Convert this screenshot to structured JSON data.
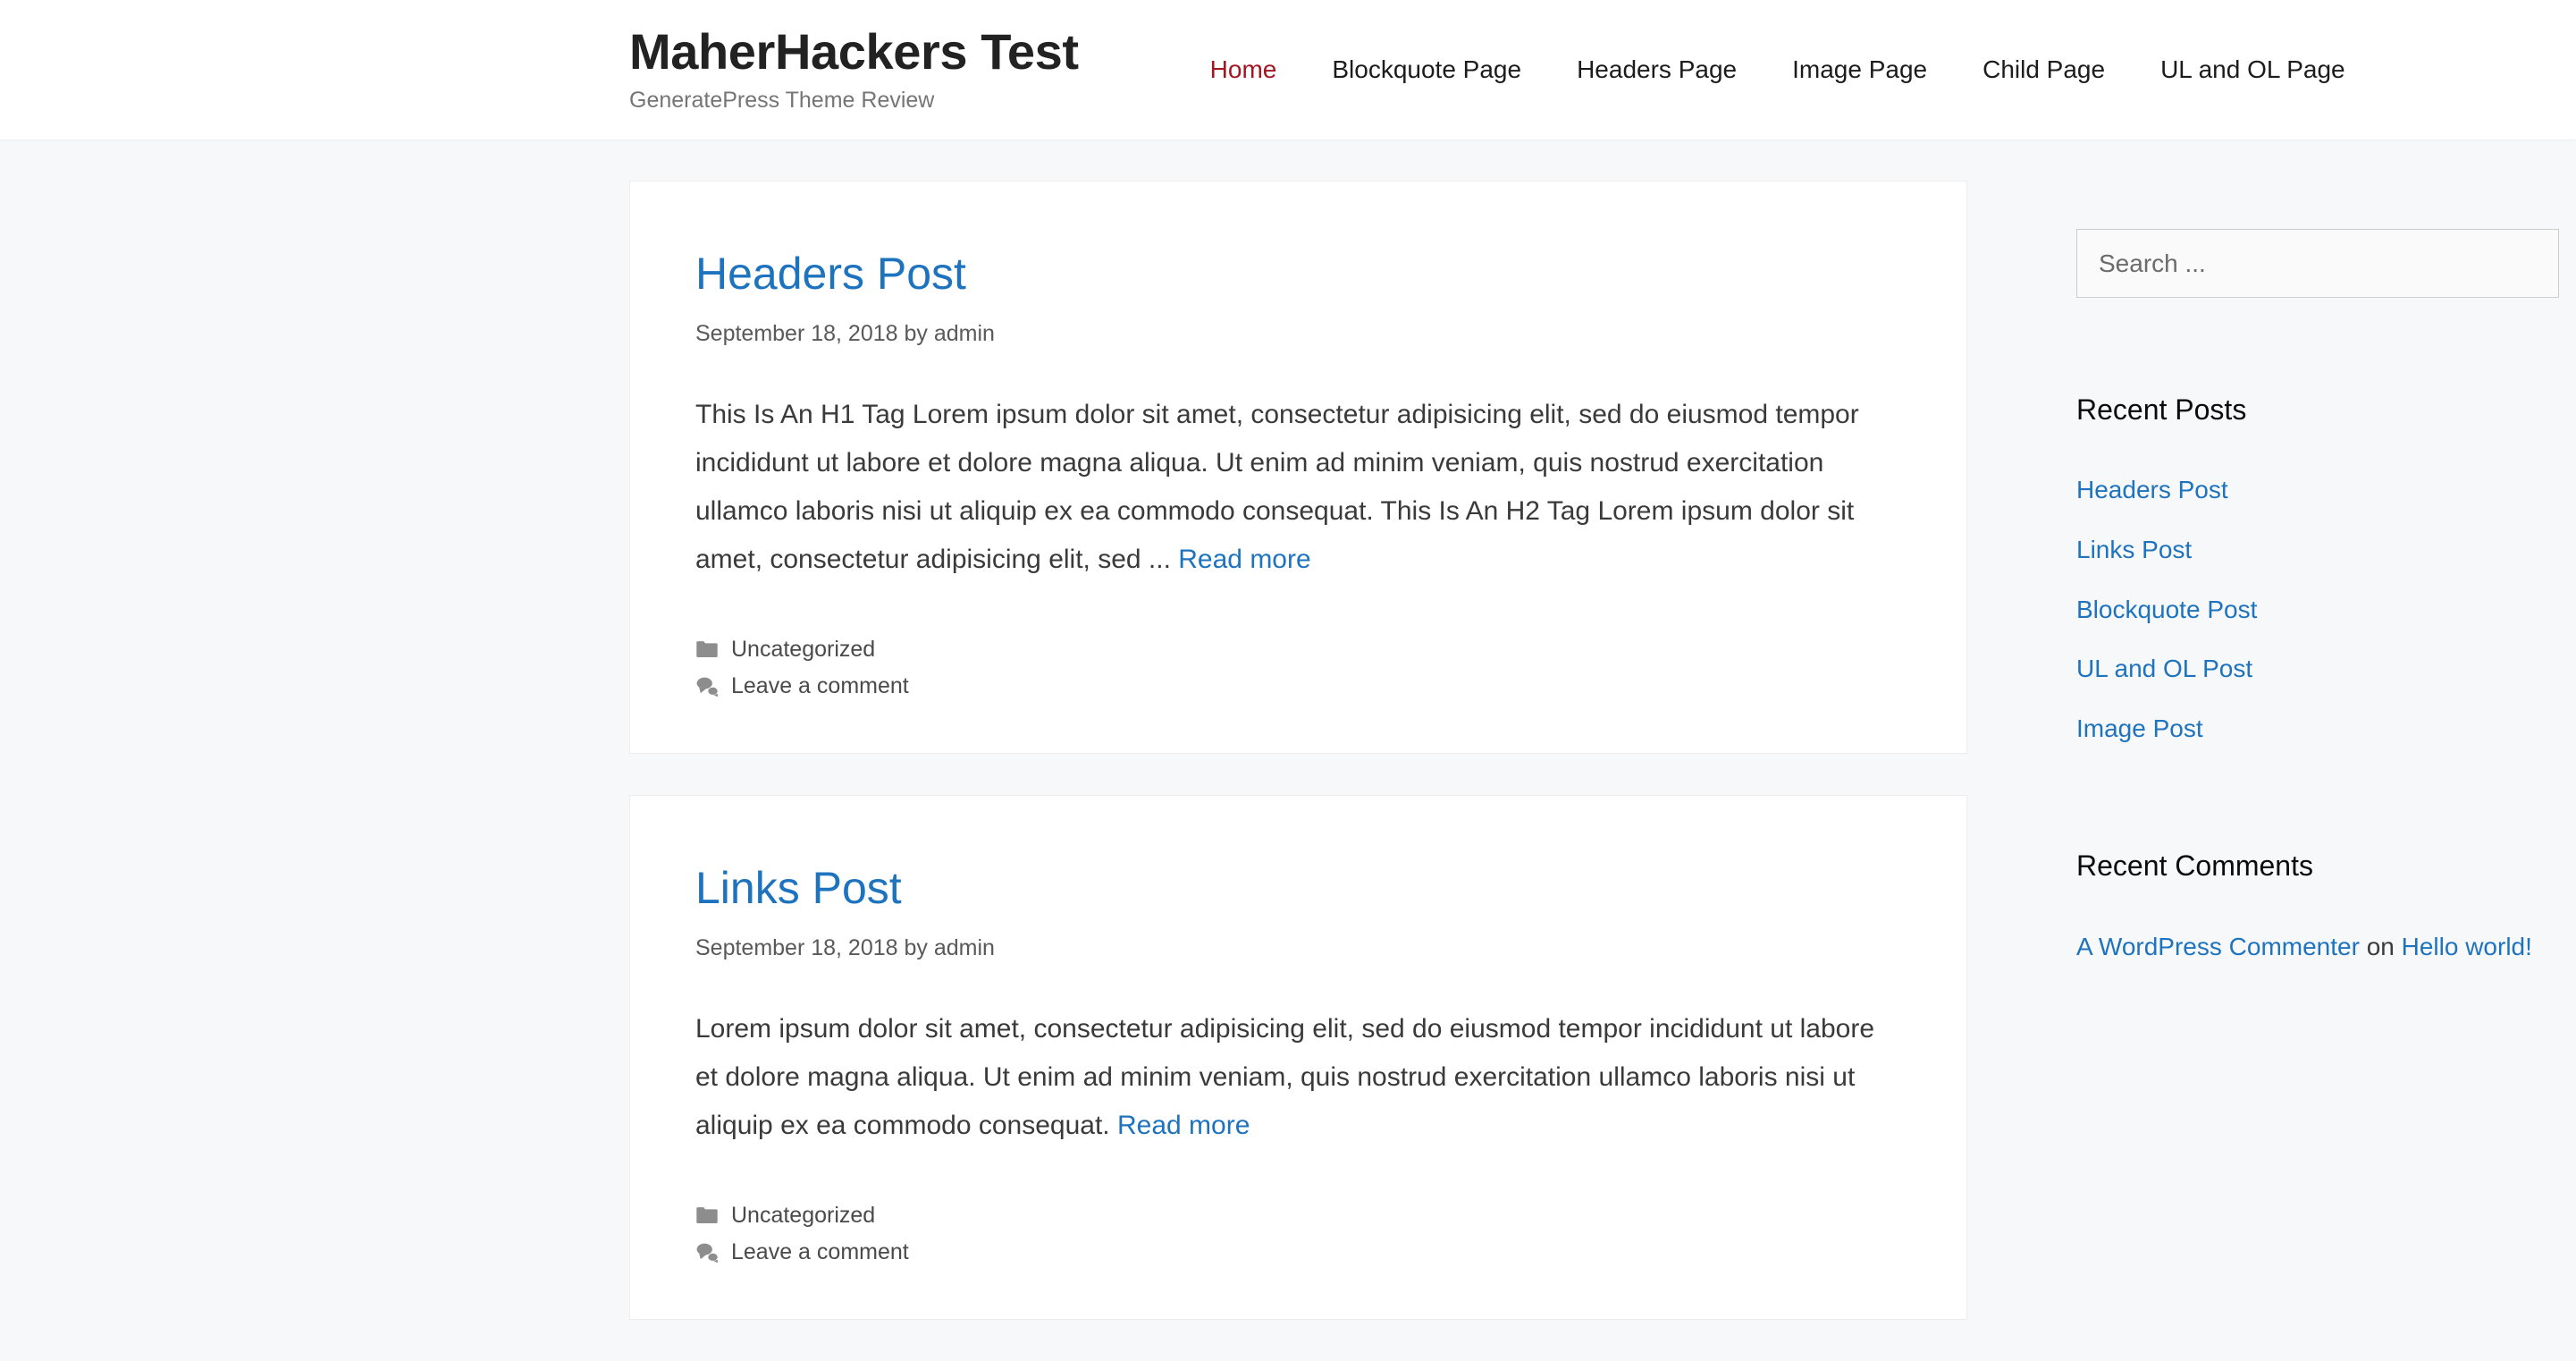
{
  "header": {
    "site_title": "MaherHackers Test",
    "site_description": "GeneratePress Theme Review",
    "nav": [
      {
        "label": "Home",
        "current": true
      },
      {
        "label": "Blockquote Page",
        "current": false
      },
      {
        "label": "Headers Page",
        "current": false
      },
      {
        "label": "Image Page",
        "current": false
      },
      {
        "label": "Child Page",
        "current": false
      },
      {
        "label": "UL and OL Page",
        "current": false
      }
    ]
  },
  "posts": [
    {
      "title": "Headers Post",
      "meta": "September 18, 2018 by admin",
      "excerpt": "This Is An H1 Tag Lorem ipsum dolor sit amet, consectetur adipisicing elit, sed do eiusmod tempor incididunt ut labore et dolore magna aliqua. Ut enim ad minim veniam, quis nostrud exercitation ullamco laboris nisi ut aliquip ex ea commodo consequat. This Is An H2 Tag Lorem ipsum dolor sit amet, consectetur adipisicing elit, sed ... ",
      "read_more": "Read more",
      "category": "Uncategorized",
      "comments": "Leave a comment"
    },
    {
      "title": "Links Post",
      "meta": "September 18, 2018 by admin",
      "excerpt": "Lorem ipsum dolor sit amet, consectetur adipisicing elit, sed do eiusmod tempor incididunt ut labore et dolore magna aliqua. Ut enim ad minim veniam, quis nostrud exercitation ullamco laboris nisi ut aliquip ex ea commodo consequat. ",
      "read_more": "Read more",
      "category": "Uncategorized",
      "comments": "Leave a comment"
    }
  ],
  "sidebar": {
    "search": {
      "placeholder": "Search ...",
      "value": ""
    },
    "recent_posts": {
      "title": "Recent Posts",
      "items": [
        "Headers Post",
        "Links Post",
        "Blockquote Post",
        "UL and OL Post",
        "Image Post"
      ]
    },
    "recent_comments": {
      "title": "Recent Comments",
      "items": [
        {
          "author": "A WordPress Commenter",
          "connector": " on ",
          "post": "Hello world!"
        }
      ]
    }
  },
  "colors": {
    "link_blue": "#1e73be",
    "nav_active_red": "#a01722",
    "page_background": "#f7f8f9",
    "card_background": "#ffffff",
    "body_text": "#3a3a3a",
    "meta_text": "#595959"
  },
  "icons": {
    "category": "folder-icon",
    "comments": "comment-bubble-icon"
  }
}
